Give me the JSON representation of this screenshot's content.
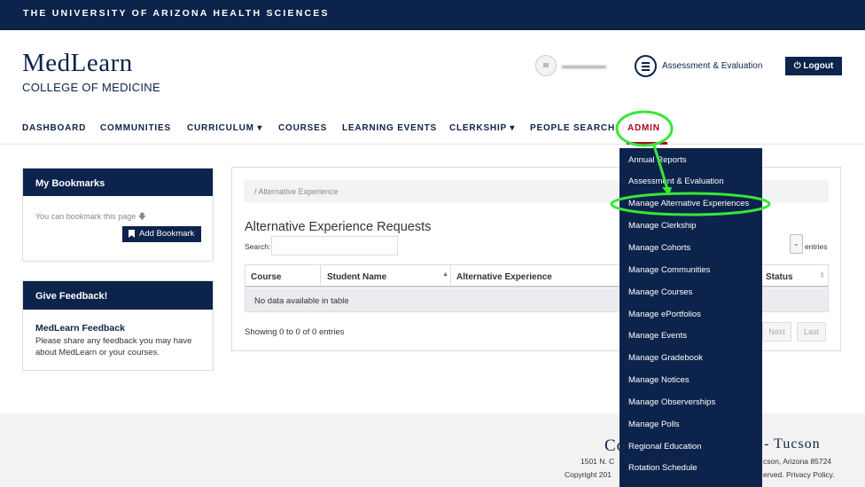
{
  "topbar": {
    "text": "THE UNIVERSITY OF ARIZONA HEALTH SCIENCES"
  },
  "logo": {
    "line1": "MedLearn",
    "line2": "COLLEGE OF MEDICINE"
  },
  "header": {
    "assessment_label": "Assessment & Evaluation",
    "logout_label": "Logout"
  },
  "nav": {
    "dashboard": "DASHBOARD",
    "communities": "COMMUNITIES",
    "curriculum": "CURRICULUM",
    "courses": "COURSES",
    "learning_events": "LEARNING EVENTS",
    "clerkship": "CLERKSHIP",
    "people_search": "PEOPLE SEARCH",
    "admin": "ADMIN",
    "caret": "▾"
  },
  "bookmarks": {
    "title": "My Bookmarks",
    "hint": "You can bookmark this page",
    "hint_arrow": "🡇",
    "button": "Add Bookmark"
  },
  "feedback": {
    "title": "Give Feedback!",
    "link": "MedLearn Feedback",
    "text": "Please share any feedback you may have about MedLearn or your courses."
  },
  "main": {
    "breadcrumb": "/  Alternative Experience",
    "title": "Alternative Experience Requests",
    "search_label": "Search:",
    "length_caret": "⌄",
    "entries_label": "entries",
    "columns": [
      "Course",
      "Student Name",
      "Alternative Experience",
      "Status"
    ],
    "sort_icon": "▲",
    "sort_icon_both": "⬍",
    "empty": "No data available in table",
    "showing": "Showing 0 to 0 of 0 entries",
    "next": "Next",
    "last": "Last"
  },
  "footer": {
    "title_left": "Co",
    "title_right": "e - Tucson",
    "addr_left": "1501 N. C",
    "addr_right": "cson, Arizona 85724",
    "copy_left": "Copyright 201",
    "copy_right": "erved. Privacy Policy."
  },
  "admin_menu": [
    "Annual Reports",
    "Assessment & Evaluation",
    "Manage Alternative Experiences",
    "Manage Clerkship",
    "Manage Cohorts",
    "Manage Communities",
    "Manage Courses",
    "Manage ePortfolios",
    "Manage Events",
    "Manage Gradebook",
    "Manage Notices",
    "Manage Observerships",
    "Manage Polls",
    "Regional Education",
    "Rotation Schedule"
  ],
  "colors": {
    "navy": "#0c234b",
    "red": "#ab0520",
    "annotation_green": "#39e639"
  }
}
